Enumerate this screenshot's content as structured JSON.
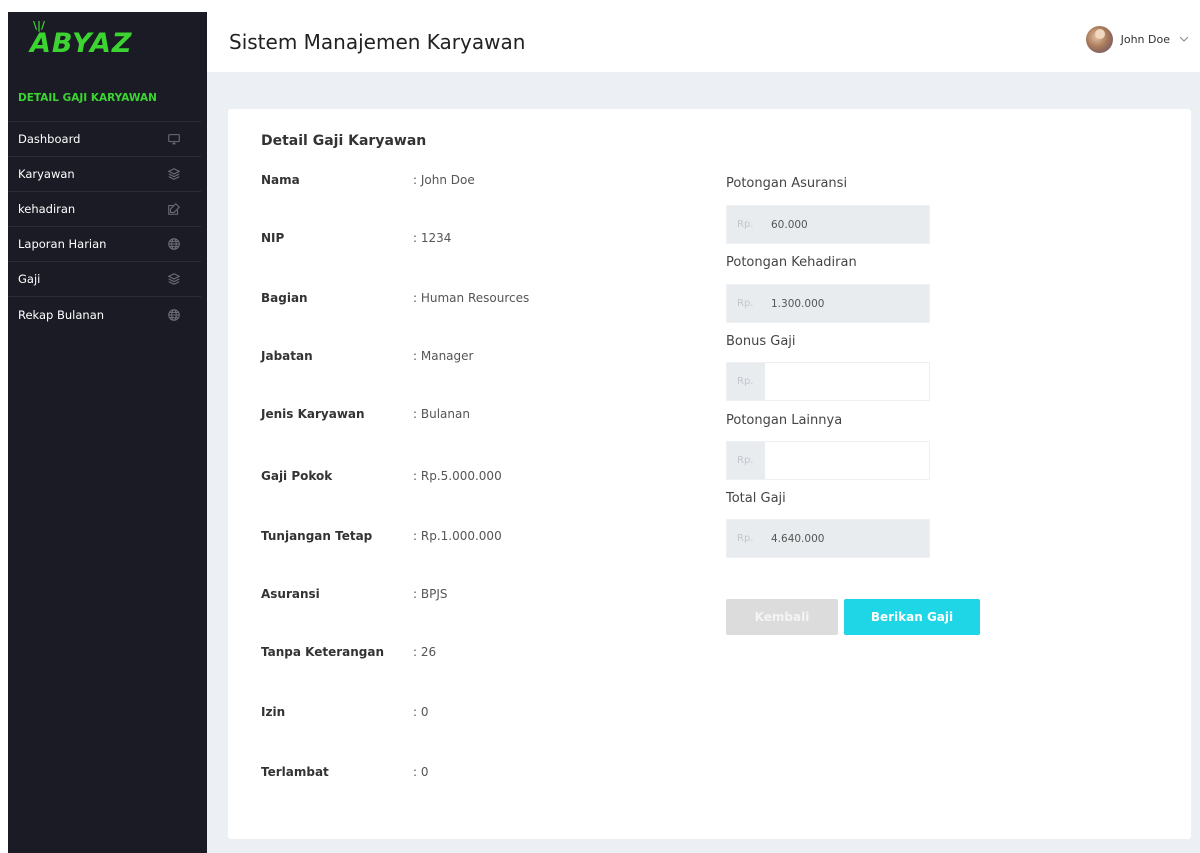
{
  "brand": {
    "logo_text": "ABYAZ",
    "accent": "#3bd431"
  },
  "sidebar": {
    "section_title": "DETAIL GAJI KARYAWAN",
    "items": [
      {
        "label": "Dashboard",
        "icon": "monitor-icon"
      },
      {
        "label": "Karyawan",
        "icon": "layers-icon"
      },
      {
        "label": "kehadiran",
        "icon": "edit-icon"
      },
      {
        "label": "Laporan Harian",
        "icon": "globe-icon"
      },
      {
        "label": "Gaji",
        "icon": "layers-icon"
      },
      {
        "label": "Rekap Bulanan",
        "icon": "globe-icon"
      }
    ]
  },
  "header": {
    "title": "Sistem Manajemen Karyawan",
    "user_name": "John Doe"
  },
  "card": {
    "title": "Detail Gaji Karyawan",
    "info": [
      {
        "label": "Nama",
        "value": ": John Doe"
      },
      {
        "label": "NIP",
        "value": ": 1234"
      },
      {
        "label": "Bagian",
        "value": ": Human Resources"
      },
      {
        "label": "Jabatan",
        "value": ": Manager"
      },
      {
        "label": "Jenis Karyawan",
        "value": ": Bulanan"
      },
      {
        "label": "Gaji Pokok",
        "value": ": Rp.5.000.000"
      },
      {
        "label": "Tunjangan Tetap",
        "value": ": Rp.1.000.000"
      },
      {
        "label": "Asuransi",
        "value": ": BPJS"
      },
      {
        "label": "Tanpa Keterangan",
        "value": ": 26"
      },
      {
        "label": "Izin",
        "value": ": 0"
      },
      {
        "label": "Terlambat",
        "value": ": 0"
      }
    ],
    "fields": [
      {
        "label": "Potongan Asuransi",
        "prefix": "Rp.",
        "value": "60.000",
        "placeholder": ""
      },
      {
        "label": "Potongan Kehadiran",
        "prefix": "Rp.",
        "value": "1.300.000",
        "placeholder": ""
      },
      {
        "label": "Bonus Gaji",
        "prefix": "Rp.",
        "value": "",
        "placeholder": ""
      },
      {
        "label": "Potongan Lainnya",
        "prefix": "Rp.",
        "value": "",
        "placeholder": ""
      },
      {
        "label": "Total Gaji",
        "prefix": "Rp.",
        "value": "4.640.000",
        "placeholder": ""
      }
    ],
    "buttons": {
      "back": "Kembali",
      "pay": "Berikan Gaji"
    }
  },
  "colors": {
    "sidebar_bg": "#1a1b25",
    "content_bg": "#eceff3",
    "primary_button": "#1ed6e6",
    "back_button": "#dcdcdc"
  }
}
